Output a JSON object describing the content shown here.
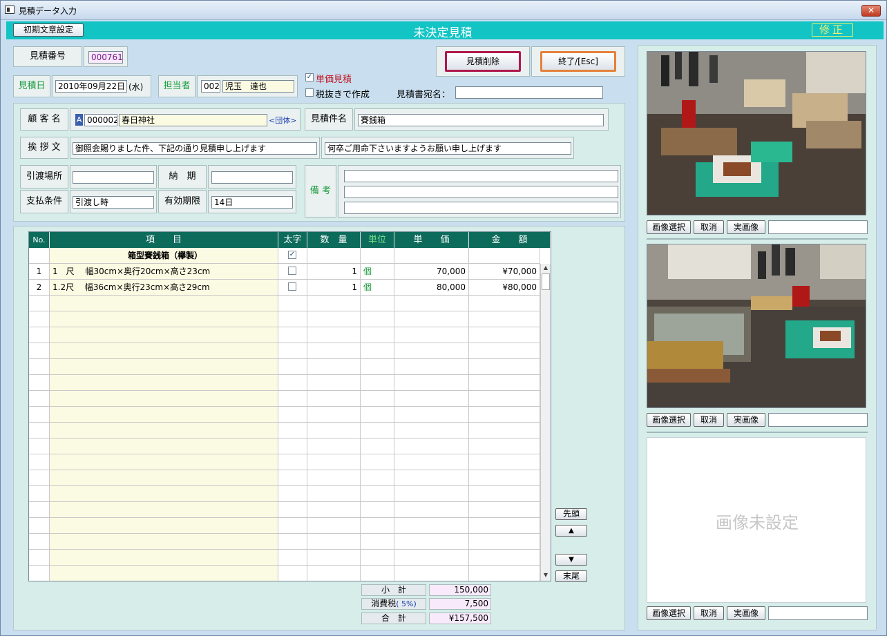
{
  "window": {
    "title": "見積データ入力",
    "close": "✕"
  },
  "header": {
    "init_button": "初期文章設定",
    "status": "未決定見積",
    "mode": "修正"
  },
  "estimate": {
    "number_label": "見積番号",
    "number": "000761",
    "date_label": "見積日",
    "date": "2010年09月22日",
    "weekday": "(水)",
    "staff_label": "担当者",
    "staff_code": "002",
    "staff_name": "児玉　達也",
    "unit_price_check_label": "単価見積",
    "unit_price_checked": true,
    "tax_excluded_label": "税抜きで作成",
    "tax_excluded_checked": false,
    "addressee_label": "見積書宛名：",
    "addressee": ""
  },
  "actions": {
    "delete": "見積削除",
    "exit": "終了/[Esc]"
  },
  "customer": {
    "name_label": "顧 客 名",
    "type_code": "A",
    "code": "000002",
    "name": "春日神社",
    "kind": "<団体>",
    "subject_label": "見積件名",
    "subject": "賽銭箱",
    "greeting_label": "挨 拶 文",
    "greeting1": "御照会賜りました件、下記の通り見積申し上げます",
    "greeting2": "何卒ご用命下さいますようお願い申し上げます",
    "delivery_place_label": "引渡場所",
    "delivery_place": "",
    "delivery_date_label": "納　期",
    "delivery_date": "",
    "payment_label": "支払条件",
    "payment": "引渡し時",
    "validity_label": "有効期限",
    "validity": "14日",
    "remarks_label": "備 考",
    "remarks": [
      "",
      "",
      ""
    ]
  },
  "table": {
    "headers": {
      "no": "No.",
      "item": "項　　目",
      "bold": "太字",
      "qty": "数　量",
      "unit": "単位",
      "price": "単　　価",
      "amount": "金　　額"
    },
    "rows": [
      {
        "no": "",
        "item": "箱型賽銭箱（欅製）",
        "bold": true,
        "qty": "",
        "unit": "",
        "price": "",
        "amount": ""
      },
      {
        "no": "1",
        "item": "1　尺　 幅30cm×奥行20cm×高さ23cm",
        "bold": false,
        "qty": "1",
        "unit": "個",
        "price": "70,000",
        "amount": "¥70,000"
      },
      {
        "no": "2",
        "item": "1.2尺　 幅36cm×奥行23cm×高さ29cm",
        "bold": false,
        "qty": "1",
        "unit": "個",
        "price": "80,000",
        "amount": "¥80,000"
      }
    ]
  },
  "nav": {
    "first": "先頭",
    "up": "▲",
    "down": "▼",
    "last": "末尾"
  },
  "totals": {
    "subtotal_label": "小　計",
    "subtotal": "150,000",
    "tax_label": "消費税",
    "tax_rate": "( 5%)",
    "tax": "7,500",
    "total_label": "合　計",
    "total": "¥157,500"
  },
  "images": {
    "select": "画像選択",
    "cancel": "取消",
    "actual": "実画像",
    "unset": "画像未設定"
  },
  "colors": {
    "teal": "#12c4c4",
    "header_green": "#0d6b5c",
    "label_green": "#179b3a",
    "delete_border": "#b0174a",
    "exit_border": "#e5813a"
  }
}
